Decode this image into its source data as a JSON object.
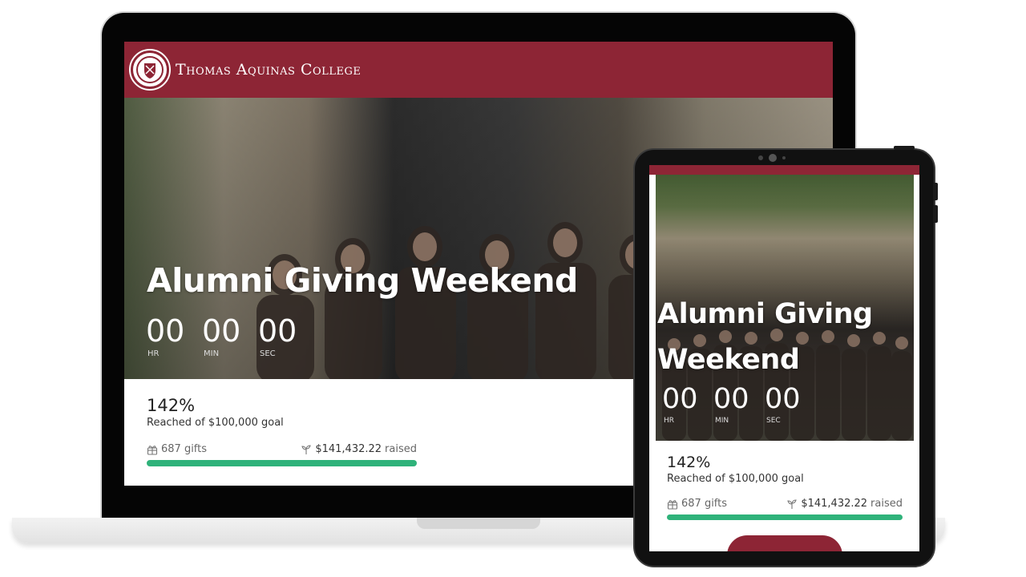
{
  "laptop": {
    "header": {
      "college_name": "Thomas Aquinas College"
    },
    "hero": {
      "title": "Alumni Giving Weekend",
      "countdown": [
        {
          "value": "00",
          "label": "HR"
        },
        {
          "value": "00",
          "label": "MIN"
        },
        {
          "value": "00",
          "label": "SEC"
        }
      ]
    },
    "stats": {
      "percent": "142%",
      "goal_text": "Reached of $100,000 goal",
      "gifts": "687 gifts",
      "amount": "$141,432.22",
      "amount_suffix": "raised",
      "progress": 1.0
    }
  },
  "tablet": {
    "hero": {
      "title": "Alumni Giving Weekend",
      "countdown": [
        {
          "value": "00",
          "label": "HR"
        },
        {
          "value": "00",
          "label": "MIN"
        },
        {
          "value": "00",
          "label": "SEC"
        }
      ]
    },
    "stats": {
      "percent": "142%",
      "goal_text": "Reached of $100,000 goal",
      "gifts": "687 gifts",
      "amount": "$141,432.22",
      "amount_suffix": "raised",
      "progress": 1.0
    }
  },
  "colors": {
    "brand": "#8d2535",
    "progress": "#2fb27a"
  },
  "icons": {
    "gift": "gift-icon",
    "sprout": "sprout-icon",
    "seal": "college-seal-logo"
  }
}
